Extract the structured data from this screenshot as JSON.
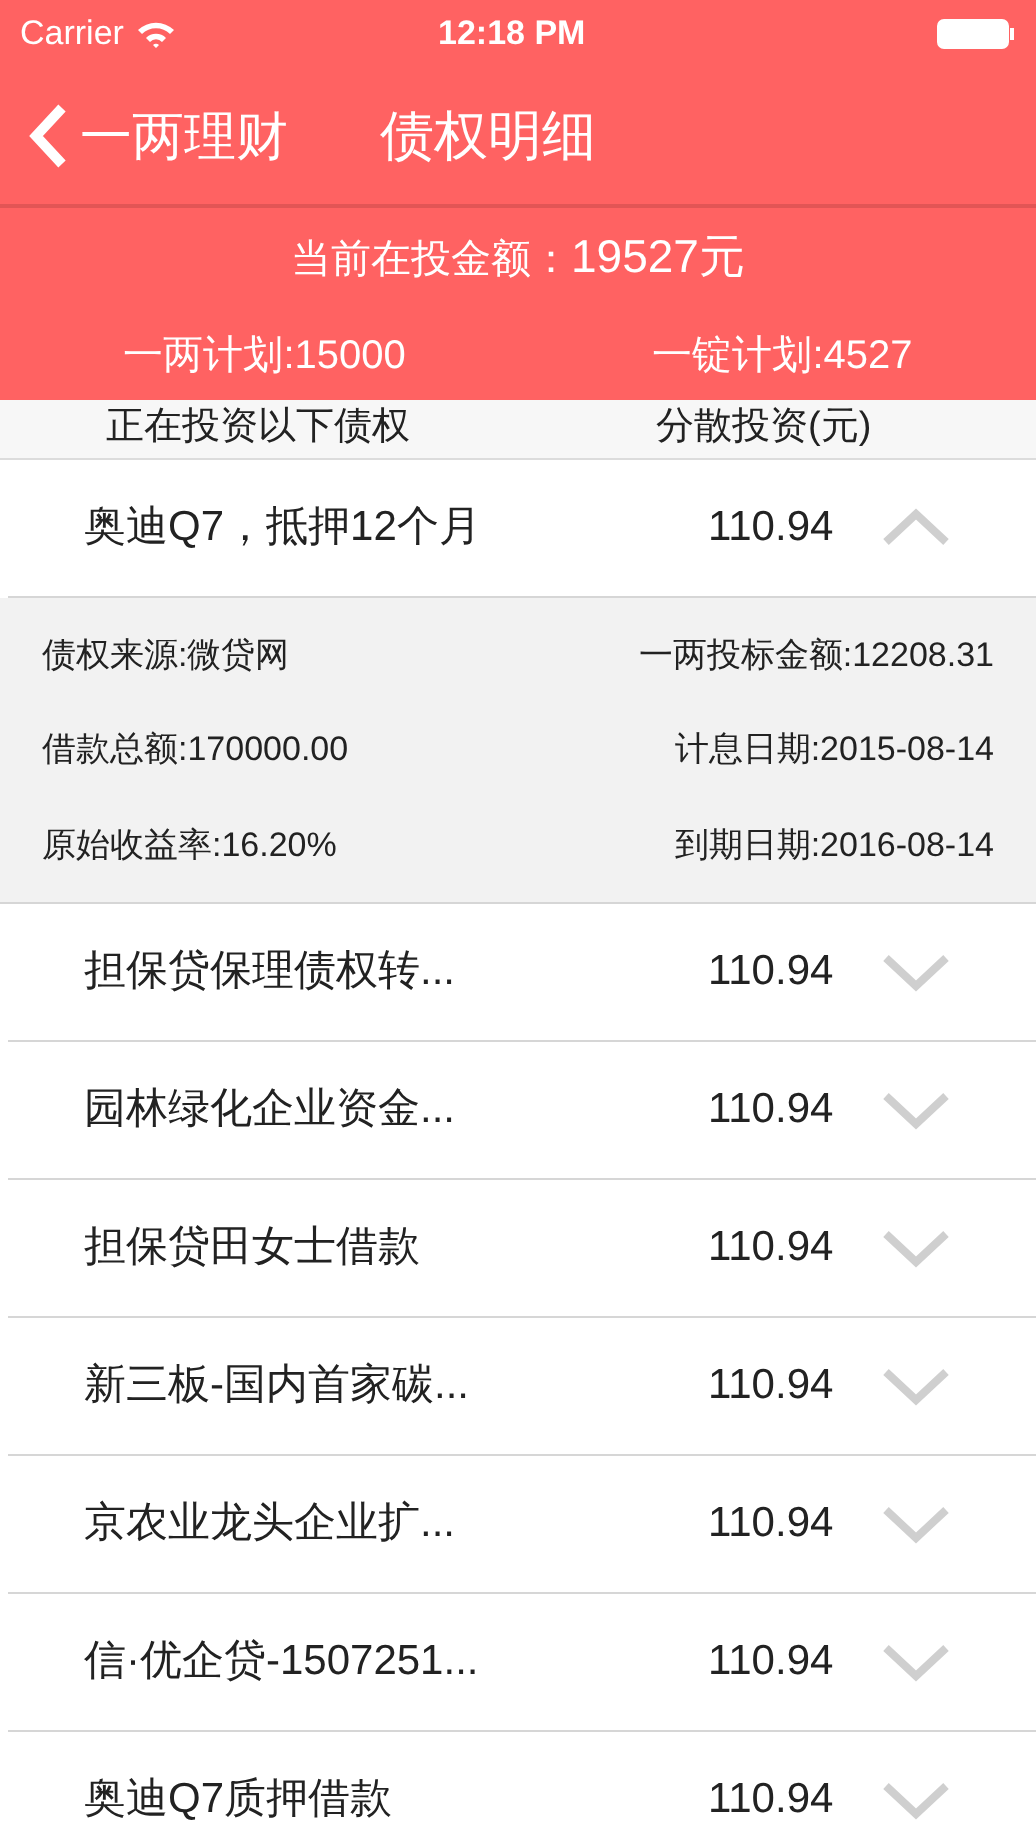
{
  "status_bar": {
    "carrier": "Carrier",
    "time": "12:18 PM"
  },
  "nav": {
    "back_label": "一两理财",
    "title": "债权明细"
  },
  "summary": {
    "total": "当前在投金额：",
    "total_value": "19527元",
    "plans": [
      "一两计划:15000",
      "一锭计划:4527"
    ]
  },
  "table": {
    "columns": [
      "正在投资以下债权",
      "分散投资(元)"
    ],
    "rows": [
      {
        "name": "奥迪Q7，抵押12个月",
        "amount": "110.94",
        "expanded": true,
        "details": [
          [
            "债权来源:微贷网",
            "一两投标金额:12208.31"
          ],
          [
            "借款总额:170000.00",
            "计息日期:2015-08-14"
          ],
          [
            "原始收益率:16.20%",
            "到期日期:2016-08-14"
          ]
        ]
      },
      {
        "name": "担保贷保理债权转...",
        "amount": "110.94",
        "expanded": false
      },
      {
        "name": "园林绿化企业资金...",
        "amount": "110.94",
        "expanded": false
      },
      {
        "name": "担保贷田女士借款",
        "amount": "110.94",
        "expanded": false
      },
      {
        "name": "新三板-国内首家碳...",
        "amount": "110.94",
        "expanded": false
      },
      {
        "name": "京农业龙头企业扩...",
        "amount": "110.94",
        "expanded": false
      },
      {
        "name": "信·优企贷-1507251...",
        "amount": "110.94",
        "expanded": false
      },
      {
        "name": "奥迪Q7质押借款",
        "amount": "110.94",
        "expanded": false
      }
    ]
  }
}
